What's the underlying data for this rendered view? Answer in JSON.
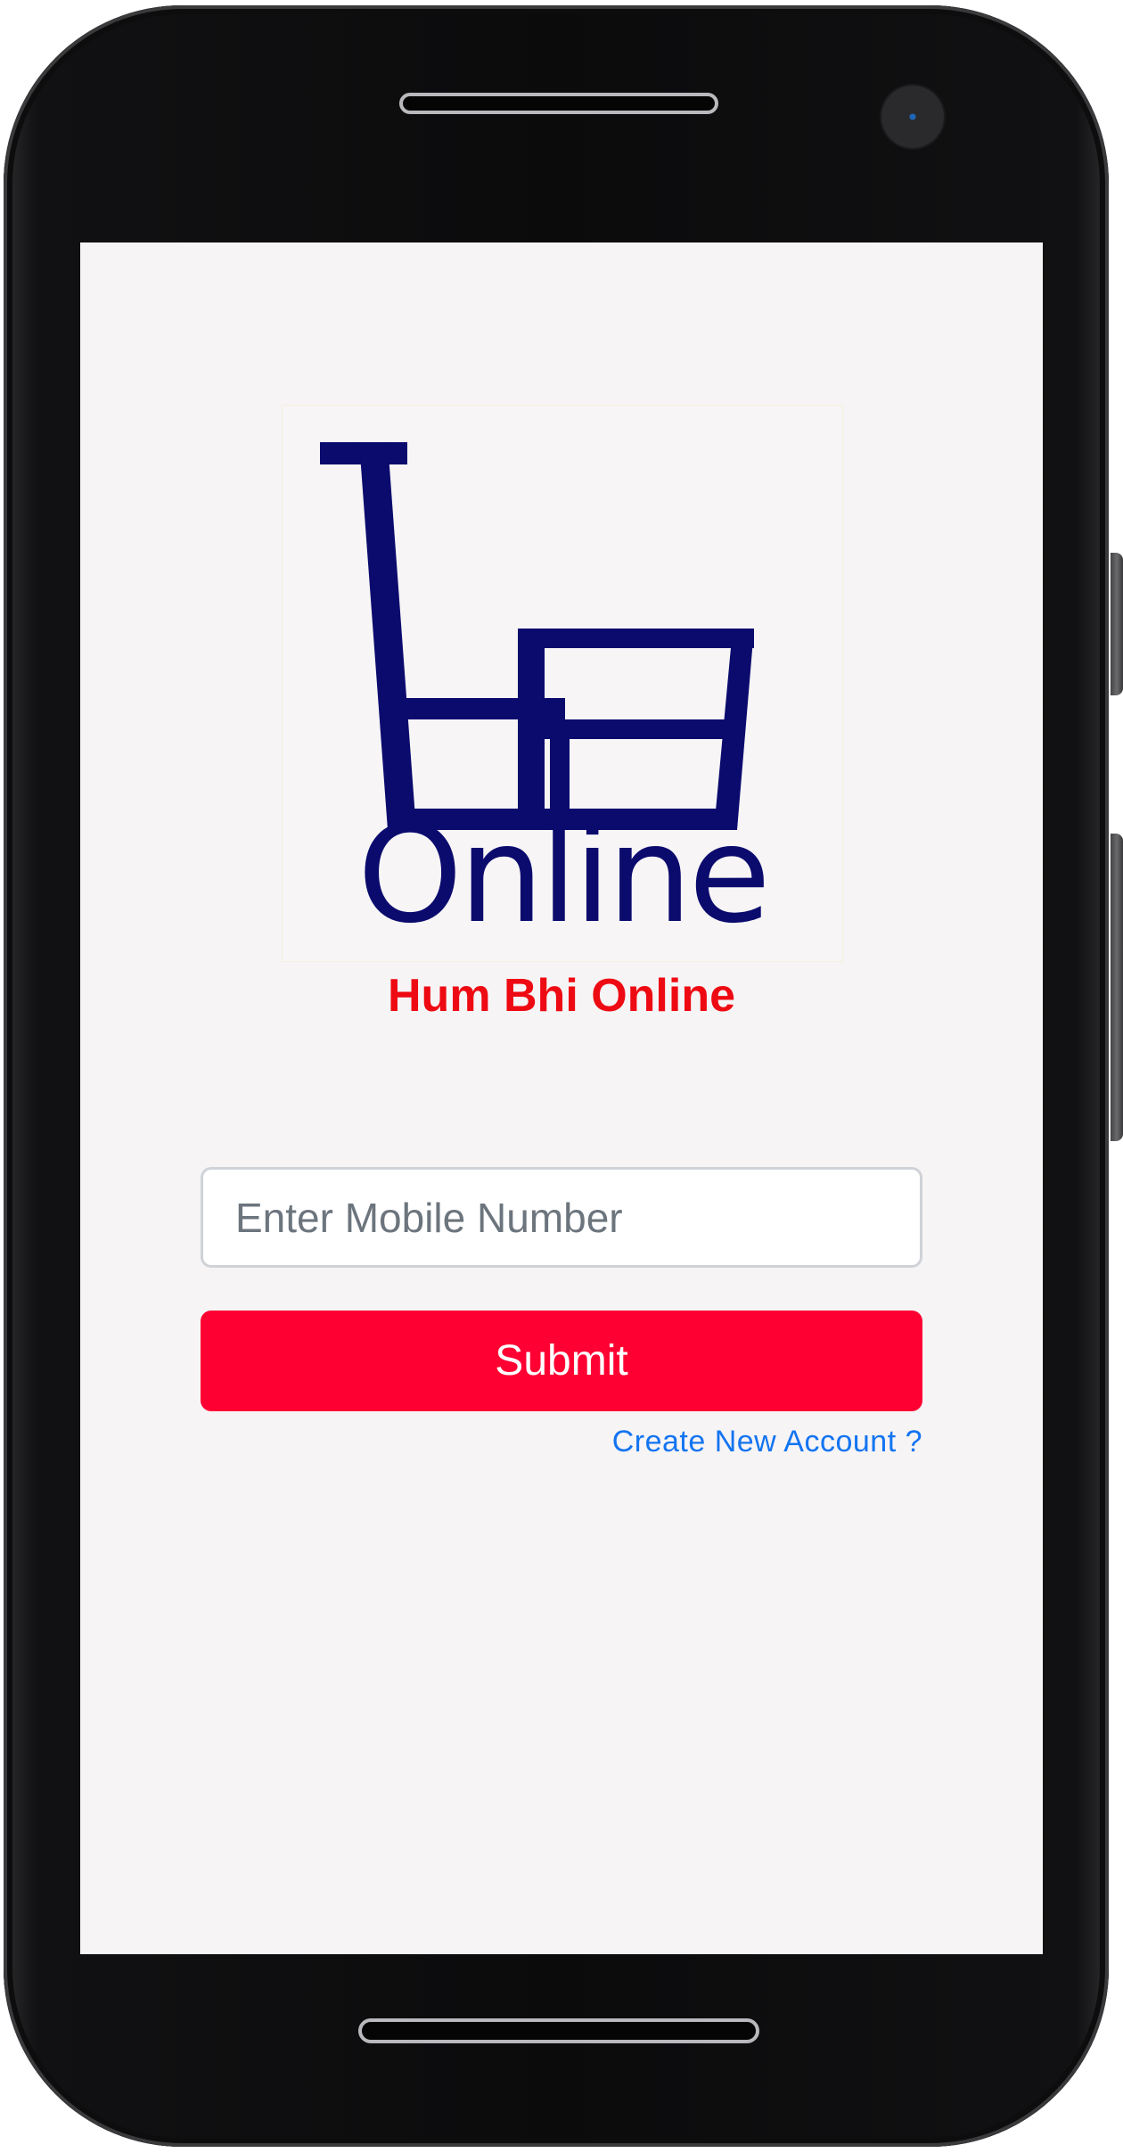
{
  "app": {
    "name": "Hum Bhi Online",
    "logo_alt": "HB Online"
  },
  "login_form": {
    "mobile_placeholder": "Enter Mobile Number",
    "mobile_value": "",
    "submit_label": "Submit",
    "create_account_label": "Create New Account ?"
  },
  "colors": {
    "title_red": "#ee0a12",
    "button_red": "#ff0033",
    "link_blue": "#1374f1",
    "logo_navy": "#0b0b6e",
    "screen_bg": "#f6f4f5"
  },
  "icons": {
    "logo": "shopping-cart-logo-icon"
  }
}
